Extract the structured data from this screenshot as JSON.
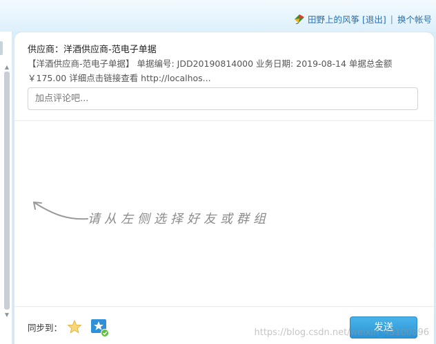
{
  "user": {
    "name": "田野上的风筝",
    "logout_label": "[退出]",
    "separator": "|",
    "switch_account_label": "换个帐号"
  },
  "message": {
    "supplier_line": "供应商：洋酒供应商-范电子单据",
    "description": "【洋酒供应商-范电子单据】  单据编号: JDD20190814000 业务日期: 2019-08-14  单据总金额 ￥175.00 详细点击链接查看 http://localhos..."
  },
  "comment": {
    "placeholder": "加点评论吧..."
  },
  "hint": {
    "text": "请从左侧选择好友或群组"
  },
  "footer": {
    "sync_label": "同步到：",
    "send_label": "发送"
  },
  "watermark": "https://blog.csdn.net/weixin_43100896",
  "colors": {
    "link": "#2a6fb0",
    "send_button": "#2a93d6",
    "background": "#d6eefa"
  },
  "icons": {
    "user": "kite-icon",
    "sync_weibo": "star-icon",
    "sync_qzone": "qzone-icon"
  }
}
